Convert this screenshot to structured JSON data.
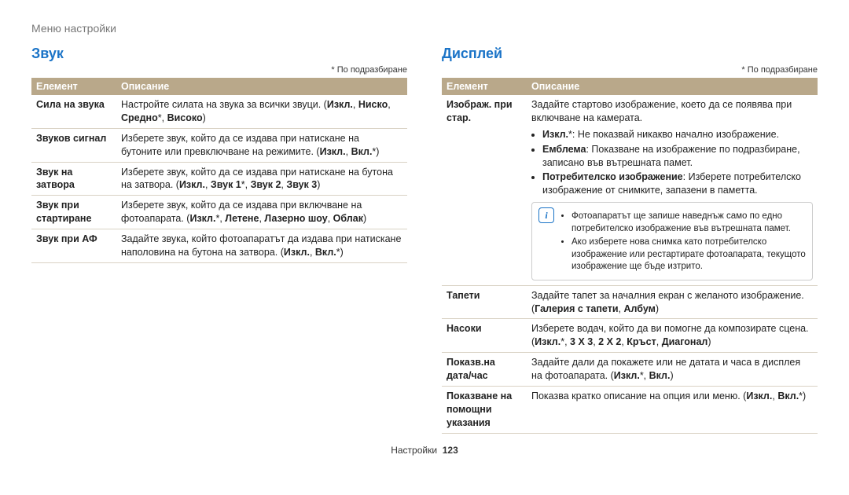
{
  "breadcrumb": "Меню настройки",
  "default_note": "* По подразбиране",
  "footer": {
    "section": "Настройки",
    "page": "123"
  },
  "headers": {
    "col1": "Елемент",
    "col2": "Описание"
  },
  "sound": {
    "title": "Звук",
    "rows": [
      {
        "label": "Сила на звука",
        "desc": "Настройте силата на звука за всички звуци. (<b>Изкл.</b>, <b>Ниско</b>, <b>Средно</b>*, <b>Високо</b>)"
      },
      {
        "label": "Звуков сигнал",
        "desc": "Изберете звук, който да се издава при натискане на бутоните или превключване на режимите. (<b>Изкл.</b>, <b>Вкл.</b>*)"
      },
      {
        "label": "Звук на затвора",
        "desc": "Изберете звук, който да се издава при натискане на бутона на затвора. (<b>Изкл.</b>, <b>Звук 1</b>*, <b>Звук 2</b>, <b>Звук 3</b>)"
      },
      {
        "label": "Звук при стартиране",
        "desc": "Изберете звук, който да се издава при включване на фотоапарата. (<b>Изкл.</b>*, <b>Летене</b>, <b>Лазерно шоу</b>, <b>Облак</b>)"
      },
      {
        "label": "Звук при АФ",
        "desc": "Задайте звука, който фотоапаратът да издава при натискане наполовина на бутона на затвора. (<b>Изкл.</b>, <b>Вкл.</b>*)"
      }
    ]
  },
  "display": {
    "title": "Дисплей",
    "rows": [
      {
        "label": "Изображ. при стар.",
        "desc_intro": "Задайте стартово изображение, което да се появява при включване на камерата.",
        "bullets": [
          "<b>Изкл.</b>*: Не показвай никакво начално изображение.",
          "<b>Емблема</b>: Показване на изображение по подразбиране, записано във вътрешната памет.",
          "<b>Потребителско изображение</b>: Изберете потребителско изображение от снимките, запазени в паметта."
        ],
        "note_bullets": [
          "Фотоапаратът ще запише наведнъж само по едно потребителско изображение във вътрешната памет.",
          "Ако изберете нова снимка като потребителско изображение или рестартирате фотоапарата, текущото изображение ще бъде изтрито."
        ]
      },
      {
        "label": "Тапети",
        "desc": "Задайте тапет за началния екран с желаното изображение. (<b>Галерия с тапети</b>, <b>Албум</b>)"
      },
      {
        "label": "Насоки",
        "desc": "Изберете водач, който да ви помогне да композирате сцена. (<b>Изкл.</b>*, <b>3 X 3</b>, <b>2 X 2</b>, <b>Кръст</b>, <b>Диагонал</b>)"
      },
      {
        "label": "Показв.на дата/час",
        "desc": "Задайте дали да покажете или не датата и часа в дисплея на фотоапарата. (<b>Изкл.</b>*, <b>Вкл.</b>)"
      },
      {
        "label": "Показване на помощни указания",
        "desc": "Показва кратко описание на опция или меню. (<b>Изкл.</b>, <b>Вкл.</b>*)"
      }
    ]
  }
}
